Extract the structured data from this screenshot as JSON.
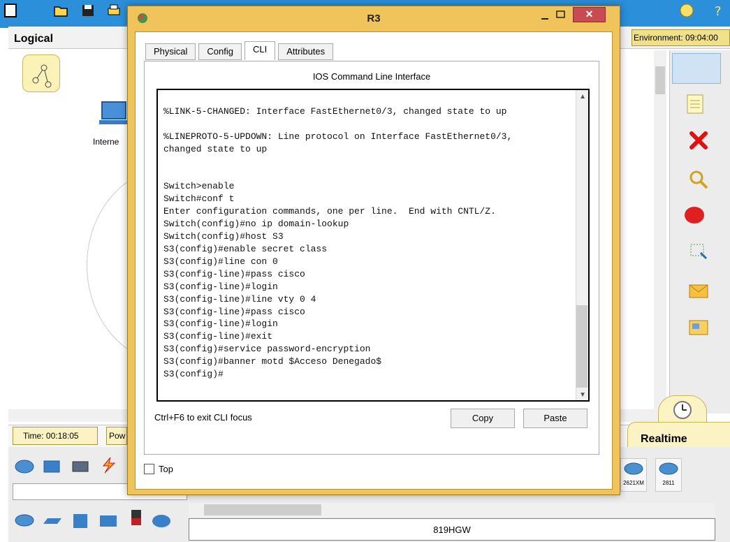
{
  "app": {
    "workspace_label": "Logical",
    "environment_label": "Environment: 09:04:00",
    "time_label": "Time: 00:18:05",
    "power_label": "Pow",
    "realtime_label": "Realtime",
    "pc_label": "Interne",
    "selected_model": "819HGW",
    "router_models": [
      "2621XM",
      "2811"
    ]
  },
  "window": {
    "title": "R3",
    "close_symbol": "✕",
    "tabs": [
      {
        "label": "Physical",
        "active": false
      },
      {
        "label": "Config",
        "active": false
      },
      {
        "label": "CLI",
        "active": true
      },
      {
        "label": "Attributes",
        "active": false
      }
    ],
    "cli_title": "IOS Command Line Interface",
    "terminal_lines": [
      "%LINK-5-CHANGED: Interface FastEthernet0/3, changed state to up",
      "",
      "%LINEPROTO-5-UPDOWN: Line protocol on Interface FastEthernet0/3,",
      "changed state to up",
      "",
      "",
      "Switch>enable",
      "Switch#conf t",
      "Enter configuration commands, one per line.  End with CNTL/Z.",
      "Switch(config)#no ip domain-lookup",
      "Switch(config)#host S3",
      "S3(config)#enable secret class",
      "S3(config)#line con 0",
      "S3(config-line)#pass cisco",
      "S3(config-line)#login",
      "S3(config-line)#line vty 0 4",
      "S3(config-line)#pass cisco",
      "S3(config-line)#login",
      "S3(config-line)#exit",
      "S3(config)#service password-encryption",
      "S3(config)#banner motd $Acceso Denegado$",
      "S3(config)#"
    ],
    "exit_hint": "Ctrl+F6 to exit CLI focus",
    "copy_label": "Copy",
    "paste_label": "Paste",
    "top_label": "Top",
    "top_checked": false
  },
  "colors": {
    "window_frame": "#f0c45b",
    "close_button": "#c74b50",
    "app_accent": "#2b8fd9",
    "delete_tool": "#e01010"
  }
}
